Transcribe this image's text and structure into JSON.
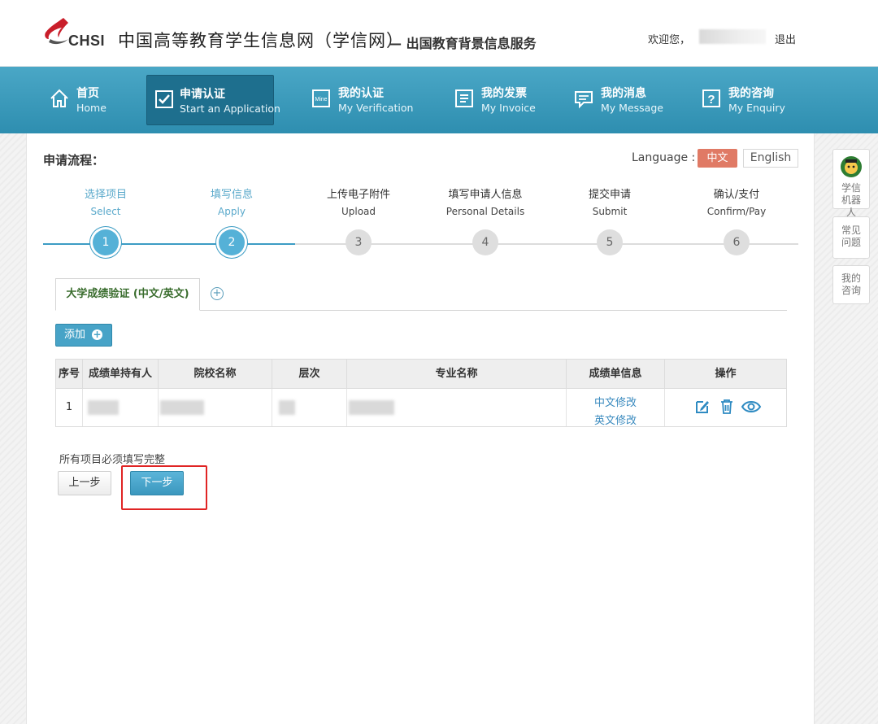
{
  "header": {
    "logo_text": "CHSI",
    "site_title": "中国高等教育学生信息网（学信网）",
    "site_sub": "— 出国教育背景信息服务",
    "welcome": "欢迎您，",
    "logout": "退出"
  },
  "nav": {
    "items": [
      {
        "label": "首页",
        "en": "Home",
        "icon": "home-icon"
      },
      {
        "label": "申请认证",
        "en": "Start an Application",
        "icon": "checkbox-icon"
      },
      {
        "label": "我的认证",
        "en": "My Verification",
        "icon": "mine-icon"
      },
      {
        "label": "我的发票",
        "en": "My Invoice",
        "icon": "invoice-icon"
      },
      {
        "label": "我的消息",
        "en": "My Message",
        "icon": "message-icon"
      },
      {
        "label": "我的咨询",
        "en": "My Enquiry",
        "icon": "question-icon"
      }
    ],
    "active_index": 1
  },
  "process": {
    "title": "申请流程：",
    "language_label": "Language :",
    "lang_cn": "中文",
    "lang_en": "English",
    "steps": [
      {
        "cn": "选择项目",
        "en": "Select",
        "num": "1",
        "done": true
      },
      {
        "cn": "填写信息",
        "en": "Apply",
        "num": "2",
        "done": true
      },
      {
        "cn": "上传电子附件",
        "en": "Upload",
        "num": "3",
        "done": false
      },
      {
        "cn": "填写申请人信息",
        "en": "Personal Details",
        "num": "4",
        "done": false
      },
      {
        "cn": "提交申请",
        "en": "Submit",
        "num": "5",
        "done": false
      },
      {
        "cn": "确认/支付",
        "en": "Confirm/Pay",
        "num": "6",
        "done": false
      }
    ]
  },
  "tabs": {
    "active": "大学成绩验证 (中文/英文)",
    "add_symbol": "+"
  },
  "add_button": "添加",
  "table": {
    "headers": [
      "序号",
      "成绩单持有人",
      "院校名称",
      "层次",
      "专业名称",
      "成绩单信息",
      "操作"
    ],
    "rows": [
      {
        "index": "1",
        "cn_edit": "中文修改",
        "en_edit": "英文修改"
      }
    ]
  },
  "footer": {
    "note": "所有项目必须填写完整",
    "prev": "上一步",
    "next": "下一步"
  },
  "sidebar": {
    "robot": "学信机器人",
    "faq": "常见问题",
    "enquiry": "我的咨询"
  },
  "colors": {
    "nav_bg": "#3a9cc0",
    "nav_active": "#1e6f8e",
    "lang_active": "#e07a65",
    "step_done": "#55b1d7",
    "link": "#3b8bbf",
    "highlight": "#e02424"
  }
}
